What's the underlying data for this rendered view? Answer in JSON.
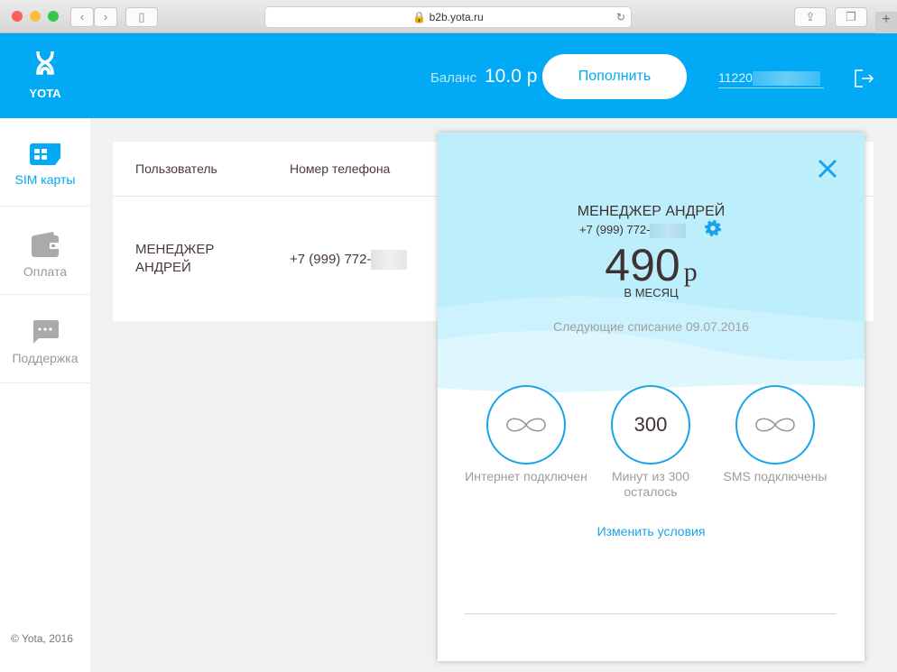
{
  "browser": {
    "url": "b2b.yota.ru",
    "new_tab": "+"
  },
  "header": {
    "logo": "YOTA",
    "balance_label": "Баланс",
    "balance_value": "10.0 р",
    "topup_label": "Пополнить",
    "account": "11220"
  },
  "sidebar": {
    "items": [
      {
        "label": "SIM карты"
      },
      {
        "label": "Оплата"
      },
      {
        "label": "Поддержка"
      }
    ],
    "copyright": "© Yota, 2016"
  },
  "table": {
    "columns": [
      "Пользователь",
      "Номер телефона"
    ],
    "rows": [
      {
        "user": "МЕНЕДЖЕР АНДРЕЙ",
        "phone": "+7 (999) 772-"
      }
    ]
  },
  "popup": {
    "name": "МЕНЕДЖЕР АНДРЕЙ",
    "phone": "+7 (999) 772-",
    "price": "490",
    "currency": "р",
    "period": "В МЕСЯЦ",
    "next_charge": "Следующие списание 09.07.2016",
    "services": [
      {
        "value": "∞",
        "label": "Интернет подключен"
      },
      {
        "value": "300",
        "label": "Минут из 300 осталось"
      },
      {
        "value": "∞",
        "label": "SMS подключены"
      }
    ],
    "change_link": "Изменить условия"
  },
  "colors": {
    "brand": "#02a9f4"
  }
}
